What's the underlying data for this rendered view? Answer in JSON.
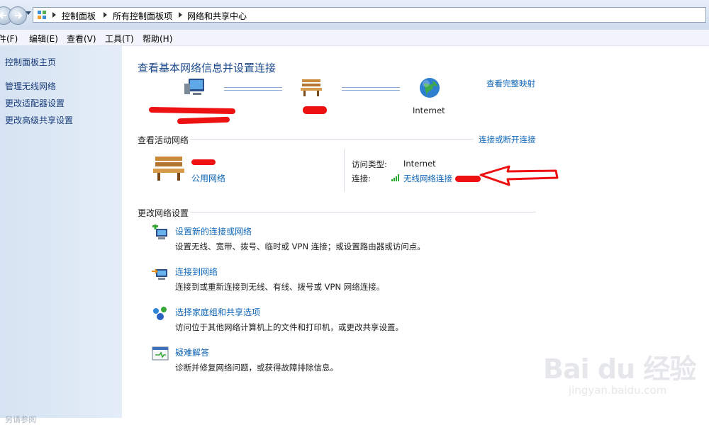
{
  "breadcrumbs": [
    "控制面板",
    "所有控制面板项",
    "网络和共享中心"
  ],
  "menu": [
    "件(F)",
    "编辑(E)",
    "查看(V)",
    "工具(T)",
    "帮助(H)"
  ],
  "sidebar": {
    "items": [
      {
        "label": "控制面板主页"
      },
      {
        "label": "管理无线网络"
      },
      {
        "label": "更改适配器设置"
      },
      {
        "label": "更改高级共享设置"
      }
    ],
    "see_also": "另请参阅"
  },
  "main": {
    "title": "查看基本网络信息并设置连接",
    "view_full_map": "查看完整映射",
    "map": {
      "internet_label": "Internet"
    },
    "active_networks": {
      "heading": "查看活动网络",
      "connect_disconnect": "连接或断开连接",
      "network_type": "公用网络",
      "access_type_label": "访问类型:",
      "access_type_value": "Internet",
      "connections_label": "连接:",
      "connection_link": "无线网络连接"
    },
    "change_settings": {
      "heading": "更改网络设置",
      "items": [
        {
          "title": "设置新的连接或网络",
          "desc": "设置无线、宽带、拨号、临时或 VPN 连接；或设置路由器或访问点。",
          "icon": "new-connection-icon"
        },
        {
          "title": "连接到网络",
          "desc": "连接到或重新连接到无线、有线、拨号或 VPN 网络连接。",
          "icon": "connect-network-icon"
        },
        {
          "title": "选择家庭组和共享选项",
          "desc": "访问位于其他网络计算机上的文件和打印机，或更改共享设置。",
          "icon": "homegroup-icon"
        },
        {
          "title": "疑难解答",
          "desc": "诊断并修复网络问题，或获得故障排除信息。",
          "icon": "troubleshoot-icon"
        }
      ]
    }
  },
  "watermark": {
    "brand": "Bai du 经验",
    "url": "jingyan.baidu.com"
  },
  "colors": {
    "link": "#0e66b8",
    "title": "#1e4a8e",
    "annotation": "#ee1111"
  }
}
